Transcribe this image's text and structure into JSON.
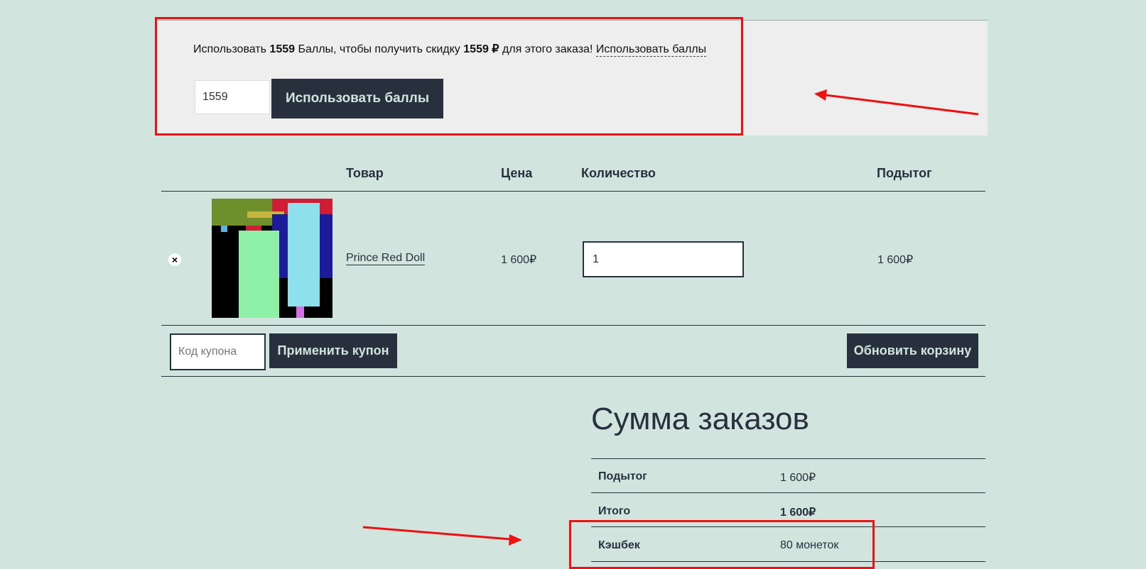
{
  "points": {
    "message_prefix": "Использовать",
    "points_amount": "1559",
    "message_mid": "Баллы, чтобы получить скидку",
    "discount_amount": "1559 ₽",
    "message_suffix": "для этого заказа!",
    "link_label": "Использовать баллы",
    "input_value": "1559",
    "apply_label": "Использовать баллы"
  },
  "cart": {
    "headers": {
      "product": "Товар",
      "price": "Цена",
      "quantity": "Количество",
      "subtotal": "Подытог"
    },
    "item": {
      "remove_symbol": "×",
      "name": "Prince Red Doll",
      "price": "1 600₽",
      "quantity": "1",
      "subtotal": "1 600₽",
      "thumbnail_icon": "product-image"
    },
    "coupon_placeholder": "Код купона",
    "apply_coupon_label": "Применить купон",
    "update_cart_label": "Обновить корзину"
  },
  "totals": {
    "title": "Сумма заказов",
    "rows": [
      {
        "label": "Подытог",
        "value": "1 600₽"
      },
      {
        "label": "Итого",
        "value": "1 600₽"
      },
      {
        "label": "Кэшбек",
        "value": "80 монеток"
      }
    ]
  },
  "colors": {
    "background": "#d1e4dd",
    "text": "#28303d",
    "button": "#28303d",
    "button_text": "#d1e4dd",
    "annotation": "#ee1111"
  }
}
